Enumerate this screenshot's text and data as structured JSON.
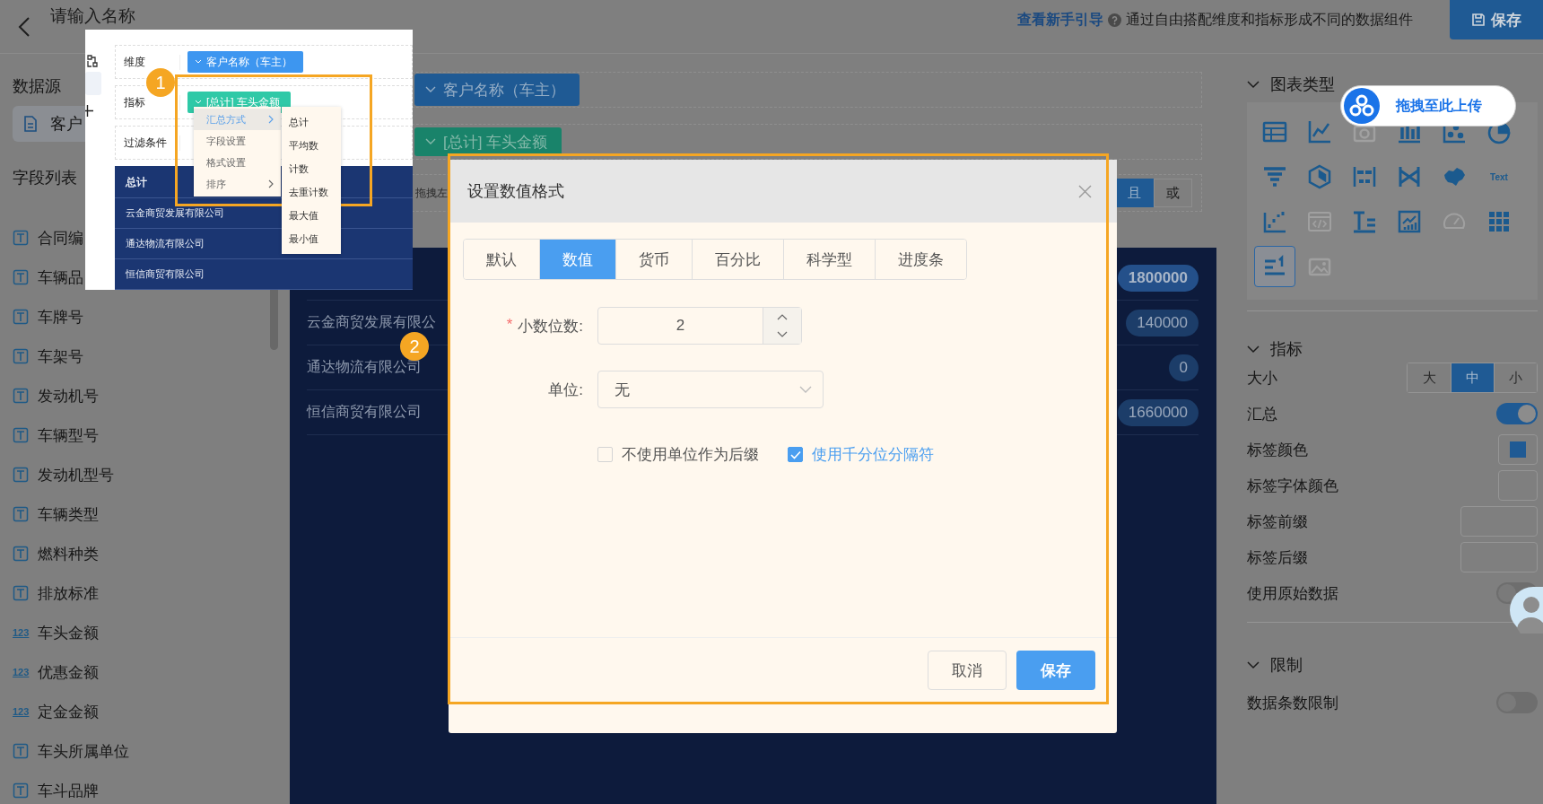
{
  "header": {
    "title": "请输入名称",
    "guide_link": "查看新手引导",
    "description": "通过自由搭配维度和指标形成不同的数据组件",
    "save_button": "保存"
  },
  "sidebar": {
    "datasource_heading": "数据源",
    "datasource": "客户",
    "fields_heading": "字段列表",
    "fields": [
      {
        "kind": "text",
        "label": "合同编"
      },
      {
        "kind": "text",
        "label": "车辆品"
      },
      {
        "kind": "text",
        "label": "车牌号"
      },
      {
        "kind": "text",
        "label": "车架号"
      },
      {
        "kind": "text",
        "label": "发动机号"
      },
      {
        "kind": "text",
        "label": "车辆型号"
      },
      {
        "kind": "text",
        "label": "发动机型号"
      },
      {
        "kind": "text",
        "label": "车辆类型"
      },
      {
        "kind": "text",
        "label": "燃料种类"
      },
      {
        "kind": "text",
        "label": "排放标准"
      },
      {
        "kind": "number",
        "type_mark": "123",
        "label": "车头金额"
      },
      {
        "kind": "number",
        "type_mark": "123",
        "label": "优惠金额"
      },
      {
        "kind": "number",
        "type_mark": "123",
        "label": "定金金额"
      },
      {
        "kind": "text",
        "label": "车头所属单位"
      },
      {
        "kind": "text",
        "label": "车斗品牌"
      }
    ]
  },
  "builder": {
    "dimension_chip": "客户名称（车主）",
    "metric_chip": "[总计] 车头金额",
    "filter_hint": "拖拽左",
    "logic": [
      {
        "label": "且",
        "selected": true
      },
      {
        "label": "或",
        "selected": false
      }
    ]
  },
  "table": {
    "rows": [
      {
        "kind": "total",
        "value": "1800000"
      },
      {
        "kind": "row",
        "name": "云金商贸发展有限公",
        "value": "140000"
      },
      {
        "kind": "row",
        "name": "通达物流有限公司",
        "value": "0"
      },
      {
        "kind": "row",
        "name": "恒信商贸有限公司",
        "value": "1660000"
      }
    ]
  },
  "settings": {
    "chart_types_heading": "图表类型",
    "chart_types": [
      {
        "kind": "table",
        "selected": false,
        "disabled": false
      },
      {
        "kind": "line",
        "selected": false,
        "disabled": false
      },
      {
        "kind": "camera",
        "selected": false,
        "disabled": true
      },
      {
        "kind": "bar",
        "selected": false,
        "disabled": false
      },
      {
        "kind": "scatter",
        "selected": false,
        "disabled": false
      },
      {
        "kind": "pie",
        "selected": false,
        "disabled": false
      },
      {
        "kind": "funnel",
        "selected": false,
        "disabled": false
      },
      {
        "kind": "hexagon",
        "selected": false,
        "disabled": false
      },
      {
        "kind": "bidir",
        "selected": false,
        "disabled": false
      },
      {
        "kind": "sankey",
        "selected": false,
        "disabled": false
      },
      {
        "kind": "map",
        "selected": false,
        "disabled": false
      },
      {
        "kind": "wordcloud",
        "caption": "Text",
        "selected": false,
        "disabled": false
      },
      {
        "kind": "step",
        "selected": false,
        "disabled": false
      },
      {
        "kind": "code",
        "selected": false,
        "disabled": true
      },
      {
        "kind": "textlines",
        "selected": false,
        "disabled": false
      },
      {
        "kind": "trend",
        "selected": false,
        "disabled": false
      },
      {
        "kind": "gauge",
        "selected": false,
        "disabled": true
      },
      {
        "kind": "grid",
        "selected": false,
        "disabled": false
      },
      {
        "kind": "ranking",
        "selected": true,
        "disabled": false
      },
      {
        "kind": "image",
        "selected": false,
        "disabled": true
      }
    ],
    "metric_heading": "指标",
    "metric_rows": [
      {
        "kind": "segmented",
        "label": "大小",
        "options": [
          {
            "label": "大",
            "selected": false
          },
          {
            "label": "中",
            "selected": true
          },
          {
            "label": "小",
            "selected": false
          }
        ]
      },
      {
        "kind": "switch",
        "label": "汇总",
        "on": true
      },
      {
        "kind": "color",
        "label": "标签颜色",
        "color": "#1f5a94"
      },
      {
        "kind": "color",
        "label": "标签字体颜色"
      },
      {
        "kind": "input",
        "label": "标签前缀"
      },
      {
        "kind": "input",
        "label": "标签后缀"
      },
      {
        "kind": "switch",
        "label": "使用原始数据",
        "on": false
      }
    ],
    "limit_heading": "限制",
    "limit_rows": [
      {
        "kind": "switch",
        "label": "数据条数限制",
        "on": false
      }
    ]
  },
  "upload_bubble": "拖拽至此上传",
  "tutorial_inset": {
    "rows": [
      {
        "kind": "dimension",
        "label": "维度",
        "chip": "客户名称（车主）"
      },
      {
        "kind": "metric",
        "label": "指标",
        "chip": "[总计] 车头金额"
      },
      {
        "label": "过滤条件"
      }
    ],
    "menu": [
      {
        "label": "汇总方式",
        "submenu": true,
        "selected": true
      },
      {
        "label": "字段设置",
        "submenu": false,
        "selected": false
      },
      {
        "label": "格式设置",
        "submenu": false,
        "selected": false
      },
      {
        "label": "排序",
        "submenu": true,
        "selected": false
      }
    ],
    "submenu": [
      "总计",
      "平均数",
      "计数",
      "去重计数",
      "最大值",
      "最小值"
    ],
    "table_rows": [
      {
        "kind": "total",
        "name": "总计"
      },
      {
        "kind": "row",
        "name": "云金商贸发展有限公司"
      },
      {
        "kind": "row",
        "name": "通达物流有限公司"
      },
      {
        "kind": "row",
        "name": "恒信商贸有限公司"
      }
    ]
  },
  "steps": [
    "1",
    "2"
  ],
  "dialog": {
    "title": "设置数值格式",
    "tabs": [
      {
        "label": "默认",
        "selected": false
      },
      {
        "label": "数值",
        "selected": true
      },
      {
        "label": "货币",
        "selected": false
      },
      {
        "label": "百分比",
        "selected": false
      },
      {
        "label": "科学型",
        "selected": false
      },
      {
        "label": "进度条",
        "selected": false
      }
    ],
    "required_mark": "*",
    "decimal_label": "小数位数:",
    "decimal_value": "2",
    "unit_label": "单位:",
    "unit_value": "无",
    "options": [
      {
        "label": "不使用单位作为后缀",
        "checked": false
      },
      {
        "label": "使用千分位分隔符",
        "checked": true
      }
    ],
    "cancel_button": "取消",
    "save_button": "保存"
  }
}
